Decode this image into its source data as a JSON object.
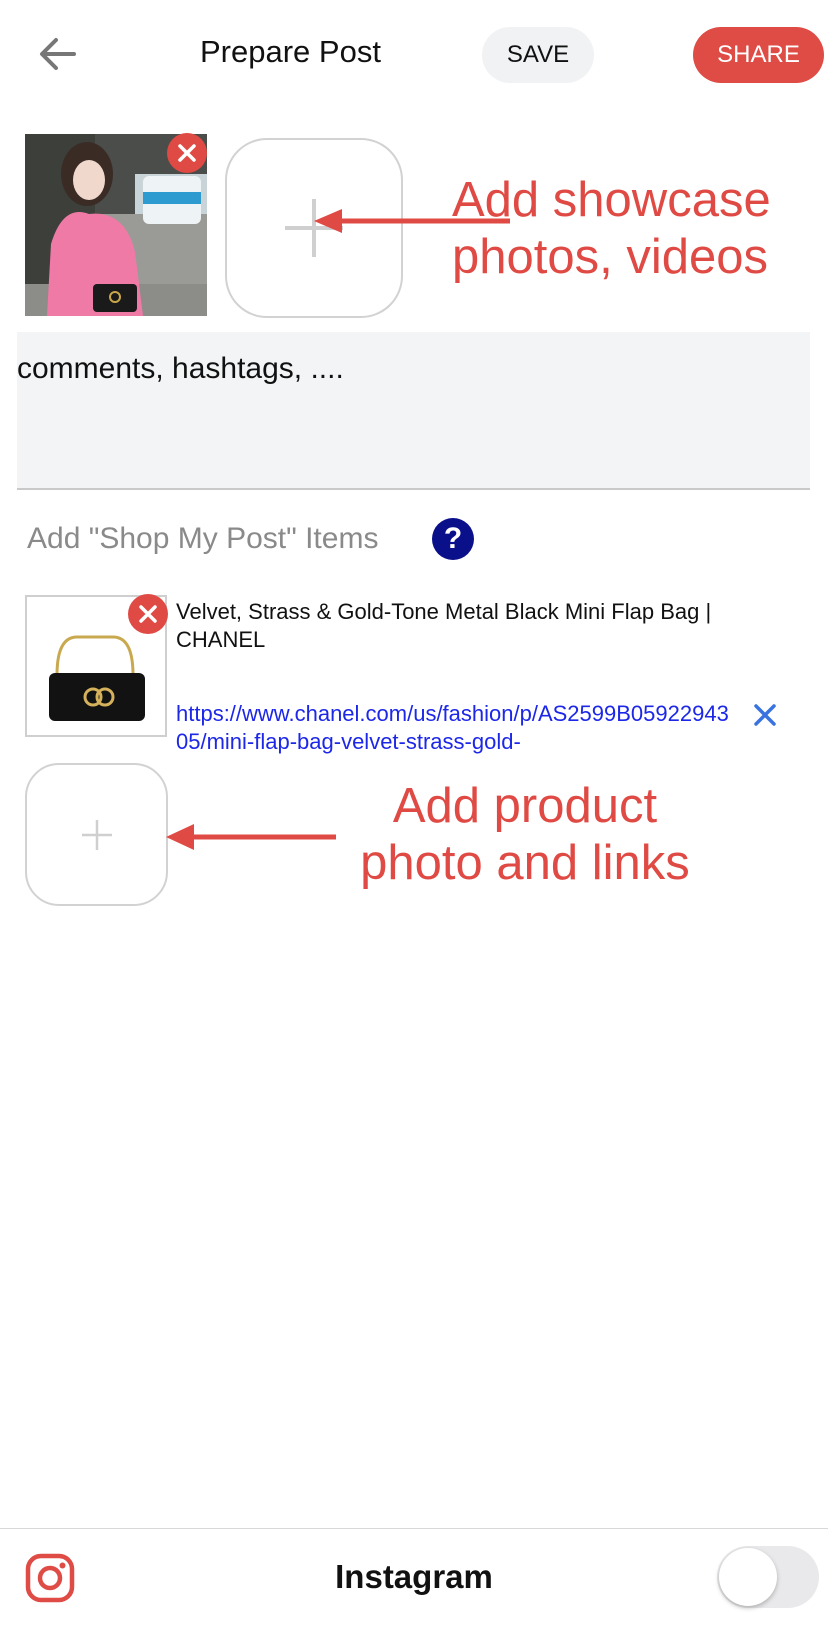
{
  "header": {
    "title": "Prepare Post",
    "save_label": "SAVE",
    "share_label": "SHARE",
    "back_icon": "arrow-left-icon"
  },
  "media": {
    "photo": "post photo of woman in pink sweater",
    "add_icon": "plus-icon",
    "remove_icon": "close-icon"
  },
  "annotations": {
    "media_line1": "Add showcase",
    "media_line2": "photos, videos",
    "product_line1": "Add product",
    "product_line2": "photo and links"
  },
  "caption": {
    "placeholder": "comments, hashtags, ...."
  },
  "shop": {
    "heading": "Add \"Shop My Post\" Items",
    "help_label": "?",
    "items": [
      {
        "name": "Velvet, Strass & Gold-Tone Metal Black Mini Flap Bag | CHANEL",
        "link": "https://www.chanel.com/us/fashion/p/AS2599B0592294305/mini-flap-bag-velvet-strass-gold-"
      }
    ]
  },
  "footer": {
    "platform": "Instagram",
    "toggle_on": false
  },
  "colors": {
    "accent": "#df4b45",
    "link": "#1c27e8",
    "help": "#0a0f8a"
  }
}
